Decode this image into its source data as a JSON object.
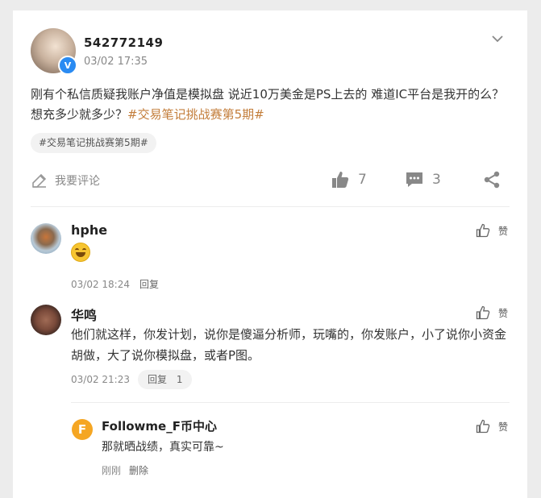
{
  "post": {
    "username": "542772149",
    "timestamp": "03/02 17:35",
    "text": "刚有个私信质疑我账户净值是模拟盘 说近10万美金是PS上去的 难道IC平台是我开的么？想充多少就多少？",
    "hashtag_inline": "#交易笔记挑战赛第5期#",
    "tag": "#交易笔记挑战赛第5期#",
    "comment_prompt": "我要评论",
    "likes": "7",
    "comments": "3"
  },
  "comments": [
    {
      "name": "hphe",
      "time": "03/02 18:24",
      "reply_label": "回复",
      "like_label": "赞"
    },
    {
      "name": "华鸣",
      "text": "他们就这样，你发计划，说你是傻逼分析师，玩嘴的，你发账户，小了说你小资金胡做，大了说你模拟盘，或者P图。",
      "time": "03/02 21:23",
      "reply_label": "回复",
      "reply_count": "1",
      "like_label": "赞"
    }
  ],
  "sub_reply": {
    "name": "Followme_F币中心",
    "avatar_letter": "F",
    "text": "那就晒战绩，真实可靠~",
    "time": "刚刚",
    "delete_label": "删除",
    "like_label": "赞"
  },
  "colors": {
    "hashtag": "#c37d3a",
    "verified": "#2a8bf2",
    "ff_avatar": "#f5a623"
  }
}
